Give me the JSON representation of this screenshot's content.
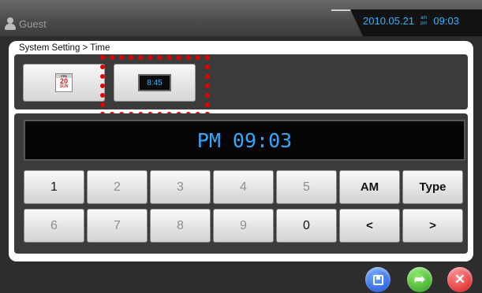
{
  "header": {
    "user": "Guest",
    "date": "2010.05.21",
    "ampm_top": "am",
    "ampm_bottom": "pm",
    "time": "09:03"
  },
  "breadcrumb": "System Setting > Time",
  "tabs": {
    "date_tab": {
      "icon": "calendar-icon",
      "month": "FEB",
      "day": "20",
      "weekday": "SUN"
    },
    "time_tab": {
      "icon": "clock-screen-icon",
      "time": "8:45",
      "selected": true
    }
  },
  "display": {
    "value": "PM 09:03"
  },
  "keypad": {
    "row1": [
      "1",
      "2",
      "3",
      "4",
      "5",
      "AM",
      "Type"
    ],
    "row2": [
      "6",
      "7",
      "8",
      "9",
      "0",
      "<",
      ">"
    ]
  },
  "footer": {
    "save_icon": "save-icon",
    "next_icon": "next-arrow-icon",
    "close_icon": "close-icon"
  },
  "colors": {
    "accent": "#2fa8ff",
    "highlight": "#e60000"
  }
}
